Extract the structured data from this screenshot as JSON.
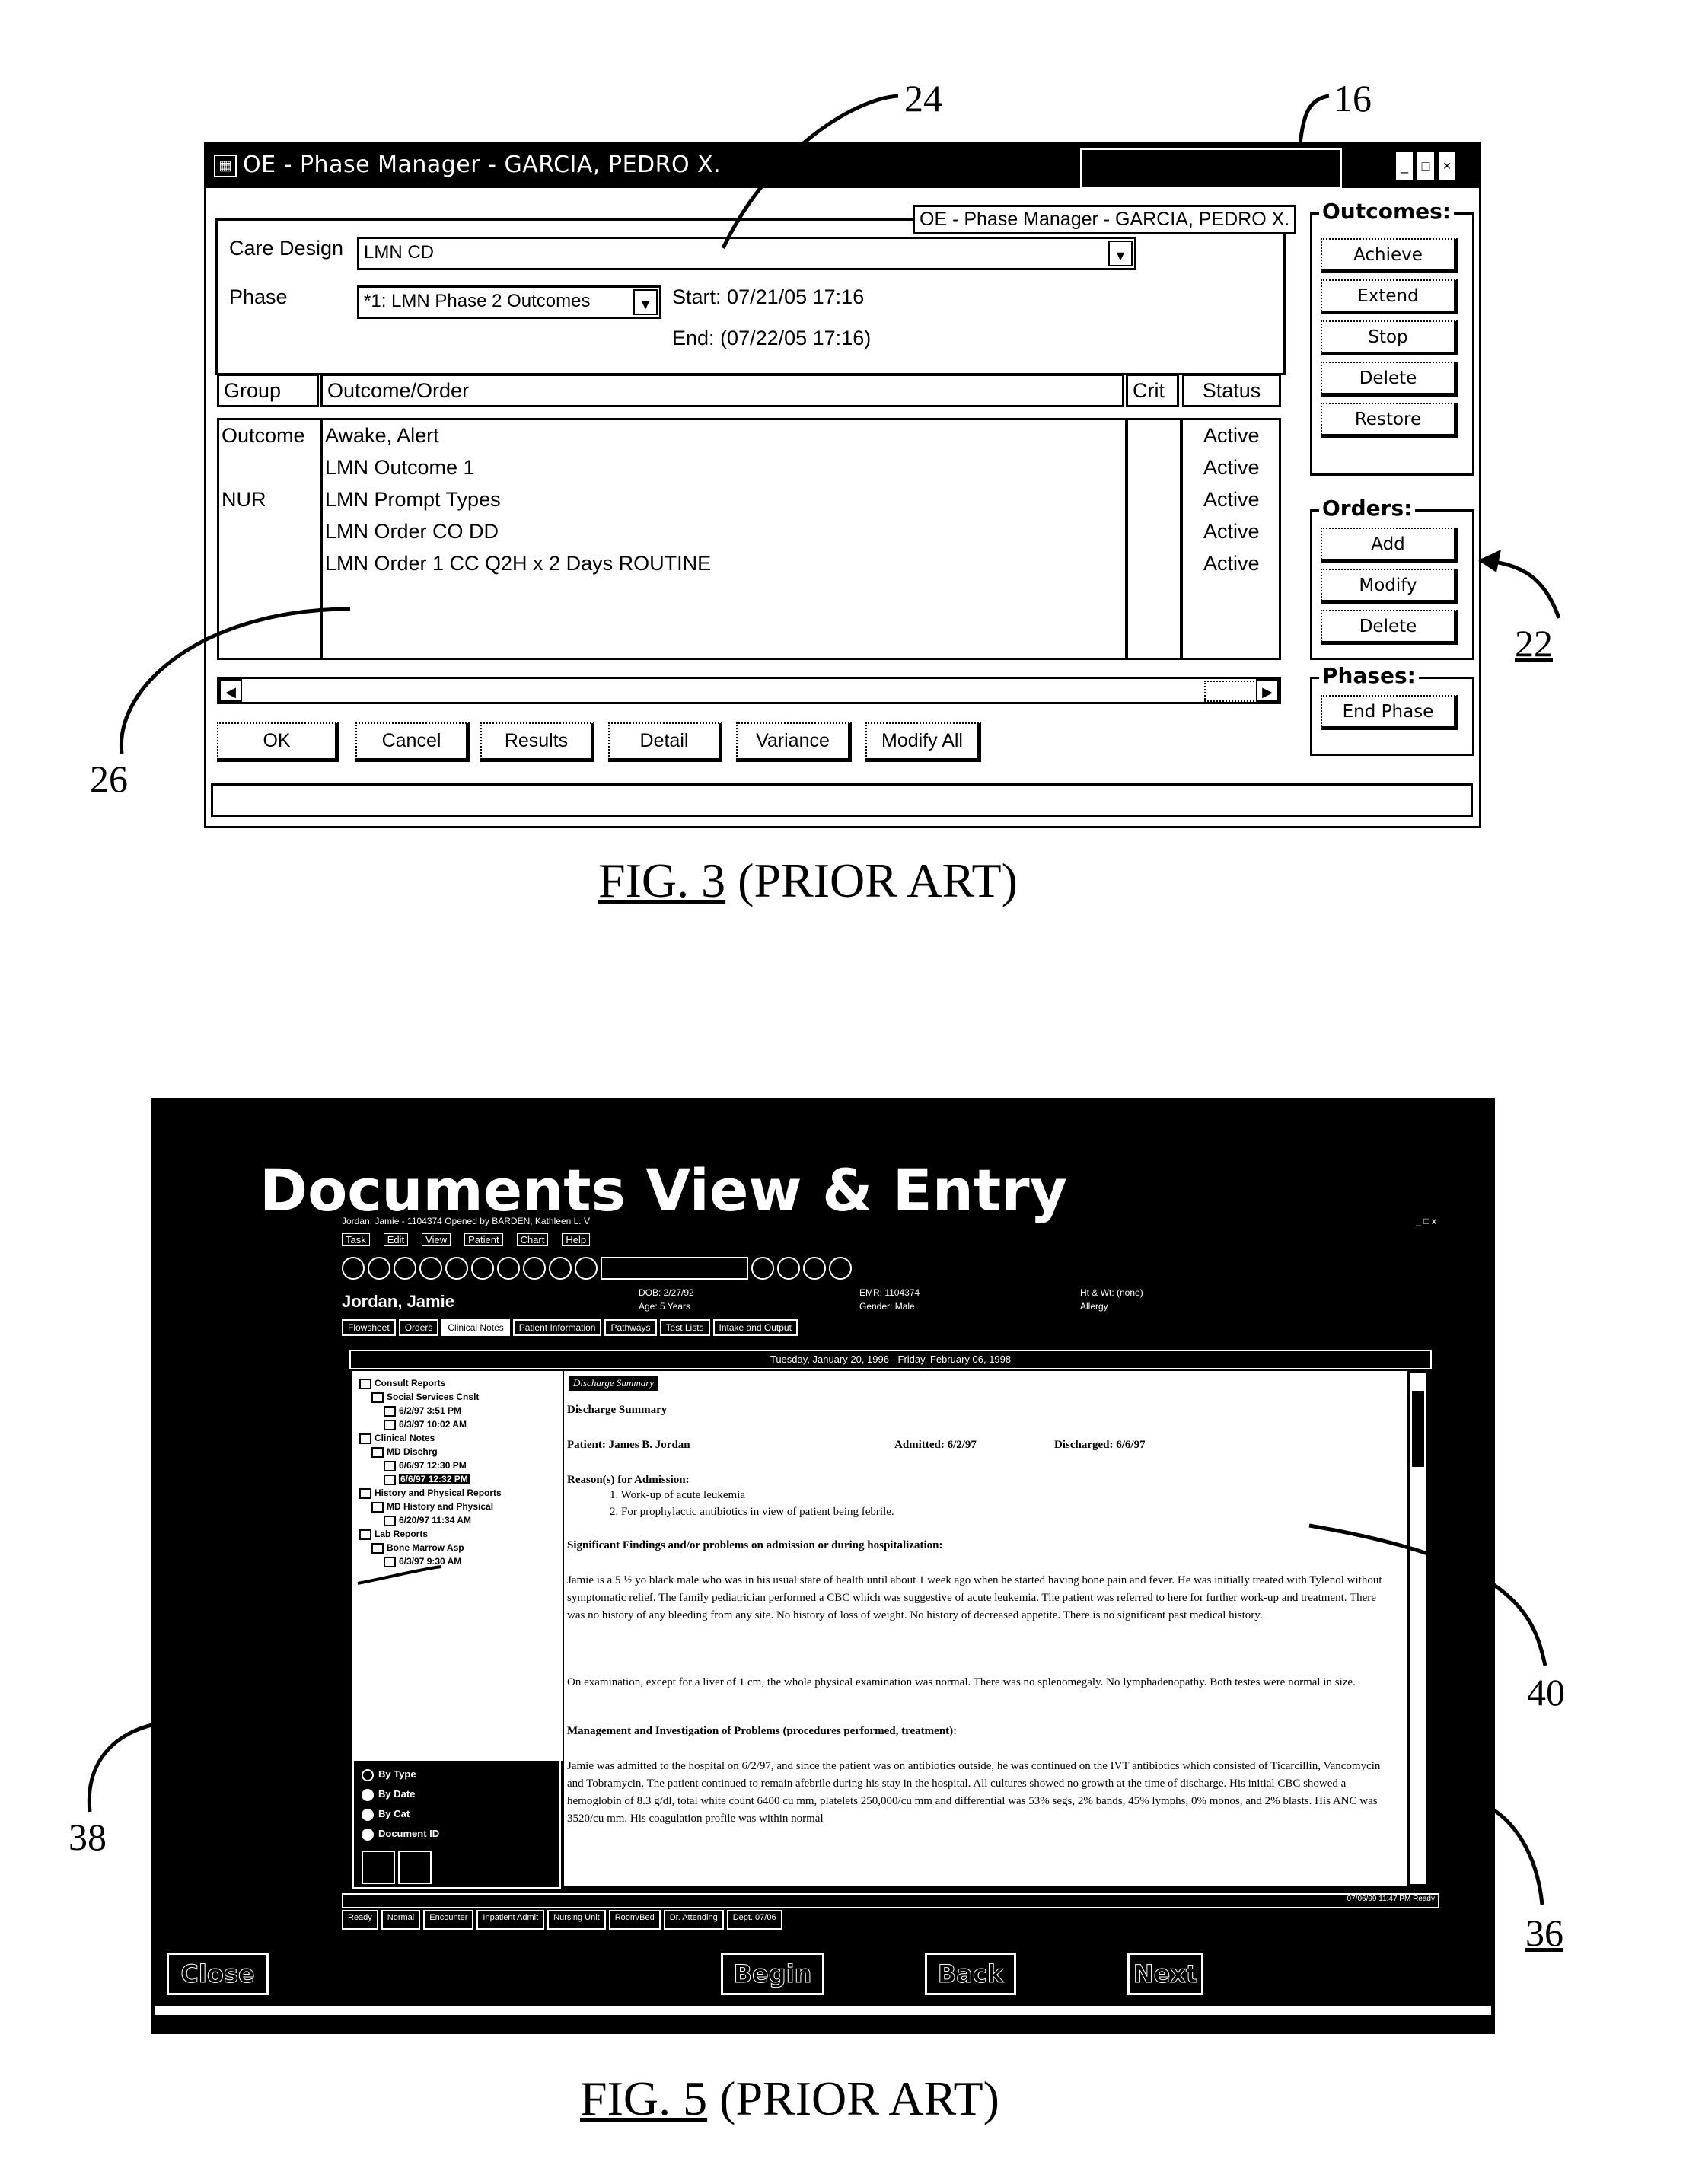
{
  "reference_numerals": {
    "n24": "24",
    "n16": "16",
    "n22": "22",
    "n26": "26",
    "n38": "38",
    "n40": "40",
    "n36": "36"
  },
  "fig3": {
    "caption_fig": "FIG. 3",
    "caption_suffix": " (PRIOR ART)",
    "window_title": "OE - Phase Manager - GARCIA, PEDRO X.",
    "tooltip": "OE - Phase Manager - GARCIA, PEDRO X.",
    "care_design_label": "Care Design",
    "care_design_value": "LMN CD",
    "phase_label": "Phase",
    "phase_value": "*1: LMN Phase 2 Outcomes",
    "start_label": "Start:",
    "start_value": "07/21/05 17:16",
    "end_label": "End:",
    "end_value": "(07/22/05 17:16)",
    "columns": {
      "group": "Group",
      "outcome_order": "Outcome/Order",
      "crit": "Crit",
      "status": "Status"
    },
    "rows": [
      {
        "group": "Outcome",
        "item": "Awake, Alert",
        "crit": "",
        "status": "Active"
      },
      {
        "group": "",
        "item": "LMN Outcome 1",
        "crit": "",
        "status": "Active"
      },
      {
        "group": "NUR",
        "item": "LMN Prompt Types",
        "crit": "",
        "status": "Active"
      },
      {
        "group": "",
        "item": "LMN Order CO DD",
        "crit": "",
        "status": "Active"
      },
      {
        "group": "",
        "item": "LMN Order 1 CC Q2H x 2 Days ROUTINE",
        "crit": "",
        "status": "Active"
      }
    ],
    "bottom_buttons": [
      "OK",
      "Cancel",
      "Results",
      "Detail",
      "Variance",
      "Modify All"
    ],
    "outcomes_group": {
      "title": "Outcomes:",
      "buttons": [
        "Achieve",
        "Extend",
        "Stop",
        "Delete",
        "Restore"
      ]
    },
    "orders_group": {
      "title": "Orders:",
      "buttons": [
        "Add",
        "Modify",
        "Delete"
      ]
    },
    "phases_group": {
      "title": "Phases:",
      "buttons": [
        "End Phase"
      ]
    },
    "icons": {
      "app": "phase-manager-app-icon",
      "minimize": "minimize-icon",
      "maximize": "maximize-icon",
      "close": "close-icon",
      "dropdown": "chevron-down-icon",
      "scroll_left": "arrow-left-icon",
      "scroll_right": "arrow-right-icon"
    }
  },
  "fig5": {
    "caption_fig": "FIG. 5",
    "caption_suffix": " (PRIOR ART)",
    "screen_title": "Documents View & Entry",
    "window_title": "Jordan, Jamie - 1104374 Opened by BARDEN, Kathleen L. V",
    "window_controls": "_ □ x",
    "menu": [
      "Task",
      "Edit",
      "View",
      "Patient",
      "Chart",
      "Help"
    ],
    "patient_name": "Jordan, Jamie",
    "banner": {
      "dob": "DOB: 2/27/92",
      "age": "Age: 5 Years",
      "emr": "EMR: 1104374",
      "gender": "Gender: Male",
      "ht_wt": "Ht & Wt: (none)",
      "allergy": "Allergy"
    },
    "tabs": [
      {
        "label": "Flowsheet",
        "selected": false
      },
      {
        "label": "Orders",
        "selected": false
      },
      {
        "label": "Clinical Notes",
        "selected": true
      },
      {
        "label": "Patient Information",
        "selected": false
      },
      {
        "label": "Pathways",
        "selected": false
      },
      {
        "label": "Test Lists",
        "selected": false
      },
      {
        "label": "Intake and Output",
        "selected": false
      }
    ],
    "date_range": "Tuesday, January 20, 1996 - Friday, February 06, 1998",
    "tree": [
      {
        "label": "Consult Reports",
        "level": 0,
        "selected": false
      },
      {
        "label": "Social Services Cnslt",
        "level": 1,
        "selected": false
      },
      {
        "label": "6/2/97 3:51 PM",
        "level": 2,
        "selected": false
      },
      {
        "label": "6/3/97 10:02 AM",
        "level": 2,
        "selected": false
      },
      {
        "label": "Clinical Notes",
        "level": 0,
        "selected": false
      },
      {
        "label": "MD Dischrg",
        "level": 1,
        "selected": false
      },
      {
        "label": "6/6/97 12:30 PM",
        "level": 2,
        "selected": false
      },
      {
        "label": "6/6/97 12:32 PM",
        "level": 2,
        "selected": true
      },
      {
        "label": "History and Physical Reports",
        "level": 0,
        "selected": false
      },
      {
        "label": "MD History and Physical",
        "level": 1,
        "selected": false
      },
      {
        "label": "6/20/97 11:34 AM",
        "level": 2,
        "selected": false
      },
      {
        "label": "Lab Reports",
        "level": 0,
        "selected": false
      },
      {
        "label": "Bone Marrow Asp",
        "level": 1,
        "selected": false
      },
      {
        "label": "6/3/97 9:30 AM",
        "level": 2,
        "selected": false
      }
    ],
    "view_options": [
      {
        "label": "By Type",
        "selected": false
      },
      {
        "label": "By Date",
        "selected": true
      },
      {
        "label": "By Cat",
        "selected": true
      },
      {
        "label": "Document ID",
        "selected": true
      }
    ],
    "document": {
      "badge": "Discharge Summary",
      "heading": "Discharge Summary",
      "patient": "Patient: James B. Jordan",
      "admitted": "Admitted: 6/2/97",
      "discharged": "Discharged: 6/6/97",
      "reasons_heading": "Reason(s) for Admission:",
      "reasons": [
        "1.    Work-up of acute leukemia",
        "2.    For prophylactic antibiotics in view of patient being febrile."
      ],
      "findings_heading": "Significant Findings and/or problems on admission or during hospitalization:",
      "findings_p1": "Jamie is a 5 ½ yo black male who was in his usual state of health until about 1 week ago when he started having bone pain and fever. He was initially treated with Tylenol without symptomatic relief. The family pediatrician performed a CBC which was suggestive of acute leukemia. The patient was referred to here for further work-up and treatment. There was no history of any bleeding from any site.  No history of loss of weight.  No history of decreased appetite. There is no significant past medical history.",
      "findings_p2": "On examination, except for a liver of 1 cm, the whole physical examination was normal. There was no splenomegaly. No lymphadenopathy.  Both testes were normal in size.",
      "management_heading": "Management and Investigation of Problems (procedures performed, treatment):",
      "management_p1": "Jamie was admitted to the hospital on 6/2/97, and since the patient was on antibiotics outside, he was continued on the IVT antibiotics which consisted of Ticarcillin, Vancomycin and Tobramycin. The patient continued to remain afebrile during his stay in the hospital. All cultures showed no growth at the time of discharge. His initial CBC showed a hemoglobin of 8.3 g/dl, total white count 6400 cu mm, platelets 250,000/cu mm and differential was 53% segs, 2% bands, 45% lymphs, 0% monos, and 2% blasts. His ANC was 3520/cu mm. His coagulation profile was within normal"
    },
    "status_right": "07/06/99 11:47 PM Ready",
    "status_panels": [
      "Ready",
      "Normal",
      "Encounter",
      "Inpatient Admit",
      "Nursing Unit",
      "Room/Bed",
      "Dr. Attending",
      "Dept. 07/06"
    ],
    "nav_buttons": {
      "close": "Close",
      "begin": "Begin",
      "back": "Back",
      "next": "Next"
    }
  }
}
